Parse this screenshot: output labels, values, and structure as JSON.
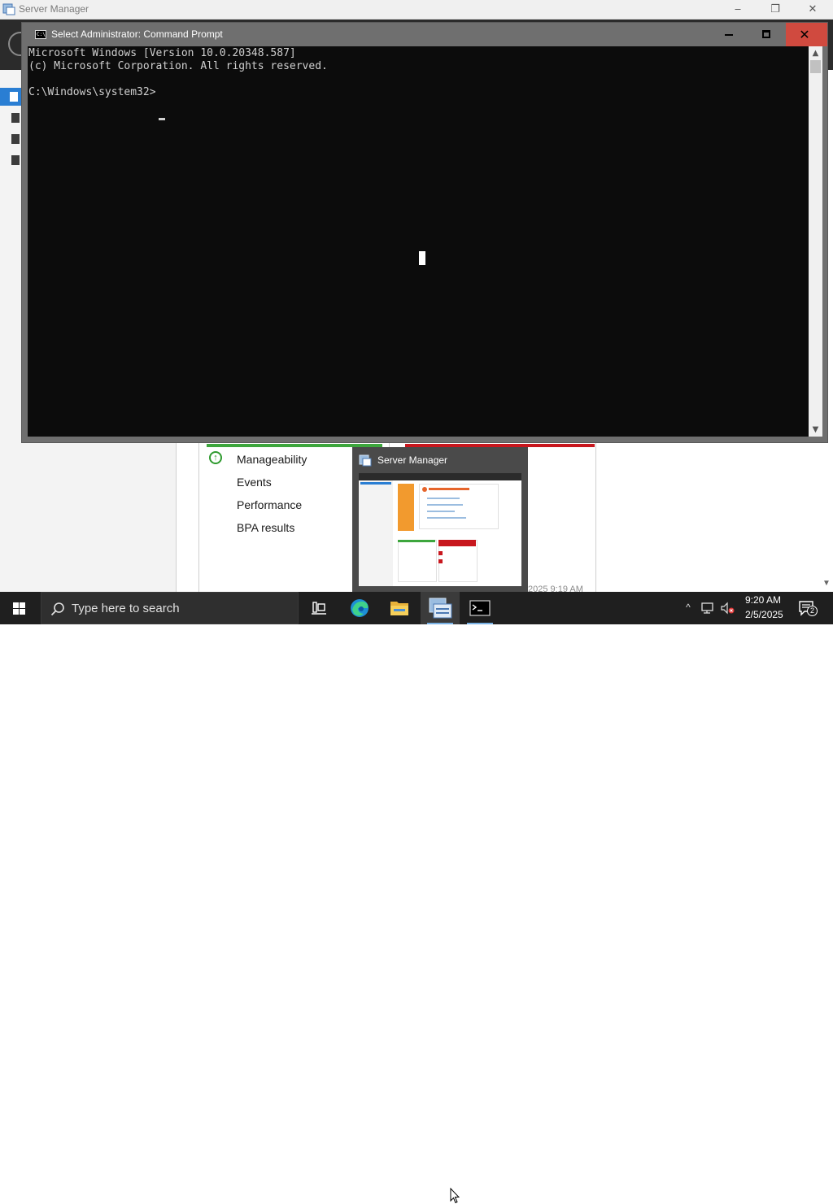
{
  "server_manager": {
    "title": "Server Manager",
    "tile": {
      "rows": [
        "Manageability",
        "Events",
        "Performance",
        "BPA results"
      ],
      "timestamp": "2025 9:19 AM"
    }
  },
  "thumbnail": {
    "title": "Server Manager"
  },
  "cmd": {
    "title": "Select Administrator: Command Prompt",
    "lines": [
      "Microsoft Windows [Version 10.0.20348.587]",
      "(c) Microsoft Corporation. All rights reserved.",
      "",
      "C:\\Windows\\system32>"
    ],
    "close_glyph": "✕"
  },
  "taskbar": {
    "search_placeholder": "Type here to search",
    "apps": [
      "task-view",
      "edge",
      "file-explorer",
      "server-manager",
      "command-prompt"
    ],
    "clock_time": "9:20 AM",
    "clock_date": "2/5/2025",
    "notification_count": "2"
  },
  "colors": {
    "cmd_title_bg": "#6f6f6f",
    "cmd_close_bg": "#d04a3f",
    "console_bg": "#0c0c0c",
    "taskbar_bg": "#1f1f1f",
    "healthy_green": "#3da63d",
    "alert_red": "#c8171e"
  }
}
